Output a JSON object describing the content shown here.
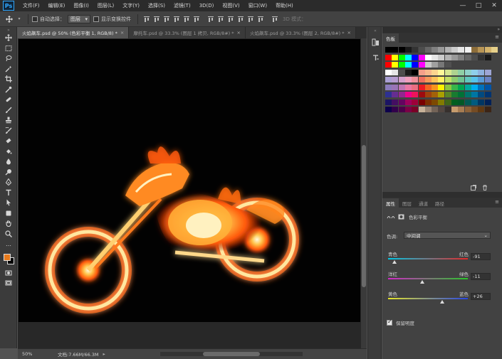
{
  "app": {
    "logo": "Ps"
  },
  "menu": [
    "文件(F)",
    "编辑(E)",
    "图像(I)",
    "图层(L)",
    "文字(Y)",
    "选择(S)",
    "滤镜(T)",
    "3D(D)",
    "视图(V)",
    "窗口(W)",
    "帮助(H)"
  ],
  "options": {
    "auto_select_label": "自动选择：",
    "auto_select_value": "图层",
    "show_transform_label": "显示变换控件",
    "mode_3d_label": "3D 模式："
  },
  "tabs": [
    {
      "label": "火焰飙车.psd @ 50% (色彩平衡 1, RGB/8) *",
      "active": true
    },
    {
      "label": "摩托车.psd @ 33.3% (图层 1 拷贝, RGB/8#) *",
      "active": false
    },
    {
      "label": "火焰飙车.psd @ 33.3% (图层 2, RGB/8#) *",
      "active": false
    }
  ],
  "status": {
    "zoom": "50%",
    "doc_size": "文档:7.66M/66.3M"
  },
  "swatches": {
    "tab": "色板",
    "rows": [
      [
        "#000000",
        "#000000",
        "#000000",
        "#1a1a1a",
        "#333333",
        "#4d4d4d",
        "#666666",
        "#808080",
        "#999999",
        "#b3b3b3",
        "#cccccc",
        "#e6e6e6",
        "#f2f2f2",
        "#8c6d3a",
        "#b89555",
        "#d4b36b",
        "#e6d08a"
      ],
      [
        "#ff0000",
        "#ffff00",
        "#00ff00",
        "#00ffff",
        "#0000ff",
        "#ff00ff",
        "#ffffff",
        "#e6e6e6",
        "#cccccc",
        "#b3b3b3",
        "#999999",
        "#808080",
        "#666666",
        "#4d4d4d",
        "#333333",
        "#1a1a1a"
      ],
      [
        "#ff0000",
        "#ffff00",
        "#00ff00",
        "#00ffff",
        "#0000ff",
        "#ff00ff",
        "#c8c8c8",
        "#a0a0a0",
        "#787878",
        "#505050"
      ],
      [
        "#ffffff",
        "#e6e6e6",
        "#4d4d4d",
        "#1a1a1a",
        "#000000",
        "#f4a08a",
        "#f7b98c",
        "#fbd58f",
        "#fff799",
        "#d6e68f",
        "#aed28f",
        "#8fcfa5",
        "#8fd1c9",
        "#8fcfea",
        "#8fb2de",
        "#9ea5d5"
      ],
      [
        "#a99fd3",
        "#b69cd0",
        "#d39fcc",
        "#ef9fbd",
        "#f0909b",
        "#ee6f5e",
        "#f49a5a",
        "#fac35b",
        "#fff064",
        "#c3df68",
        "#8dca6e",
        "#6ec391",
        "#62c7bf",
        "#57c3ea",
        "#5a9bd6",
        "#6b83c4"
      ],
      [
        "#8a7bbb",
        "#9a74b6",
        "#c075b3",
        "#ea77a3",
        "#eb6e81",
        "#ec1c24",
        "#f26522",
        "#f7941d",
        "#fff200",
        "#8dc63f",
        "#39b54a",
        "#00a651",
        "#00a99d",
        "#00aeef",
        "#0072bc",
        "#0054a6"
      ],
      [
        "#2e3192",
        "#662d91",
        "#92278f",
        "#ec008c",
        "#ed145b",
        "#9e0b0f",
        "#a0410d",
        "#a36209",
        "#aba000",
        "#598527",
        "#197b30",
        "#007236",
        "#00746b",
        "#0076a3",
        "#004a80",
        "#003471"
      ],
      [
        "#1b1464",
        "#440e62",
        "#630460",
        "#9e005d",
        "#9e0039",
        "#790000",
        "#7b2e00",
        "#7d4900",
        "#827b00",
        "#406618",
        "#005e20",
        "#005826",
        "#005952",
        "#005b7f",
        "#003663",
        "#002157"
      ],
      [
        "#0d004c",
        "#32004b",
        "#4b0049",
        "#7b0046",
        "#7a0026",
        "#c7b299",
        "#998675",
        "#736357",
        "#534741",
        "#37302d",
        "#c69c6d",
        "#a67c52",
        "#8c6239",
        "#754c24",
        "#603913",
        "#3c2415"
      ]
    ]
  },
  "properties": {
    "tabs": [
      "属性",
      "图层",
      "通道",
      "路径"
    ],
    "title": "色彩平衡",
    "tone_label": "色调:",
    "tone_value": "中间调",
    "sliders": [
      {
        "left": "青色",
        "right": "红色",
        "value": "-91",
        "pos": 0.08,
        "gradient": [
          "#00c8e6",
          "#e62828"
        ]
      },
      {
        "left": "洋红",
        "right": "绿色",
        "value": "-11",
        "pos": 0.43,
        "gradient": [
          "#d228c8",
          "#28c828"
        ]
      },
      {
        "left": "黄色",
        "right": "蓝色",
        "value": "+26",
        "pos": 0.68,
        "gradient": [
          "#e6e628",
          "#2846e6"
        ]
      }
    ],
    "preserve_label": "保留明度"
  },
  "colors": {
    "foreground": "#e77a1c",
    "background": "#000000"
  }
}
